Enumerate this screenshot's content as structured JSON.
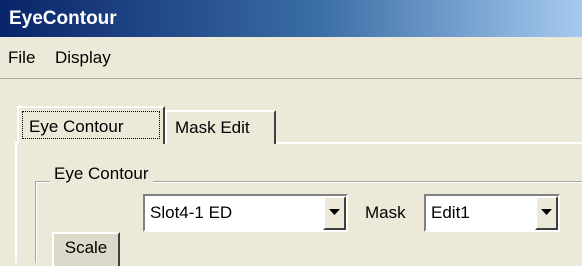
{
  "window": {
    "title": "EyeContour"
  },
  "menu": {
    "items": [
      {
        "label": "File"
      },
      {
        "label": "Display"
      }
    ]
  },
  "tabs": [
    {
      "label": "Eye Contour",
      "active": true
    },
    {
      "label": "Mask Edit",
      "active": false
    }
  ],
  "group": {
    "title": "Eye Contour"
  },
  "slot_select": {
    "value": "Slot4-1 ED"
  },
  "mask": {
    "label": "Mask",
    "value": "Edit1"
  },
  "scale_button": {
    "label": "Scale"
  },
  "colors": {
    "titlebar_start": "#0a246a",
    "titlebar_end": "#a6caf0",
    "face": "#ece9d8"
  }
}
